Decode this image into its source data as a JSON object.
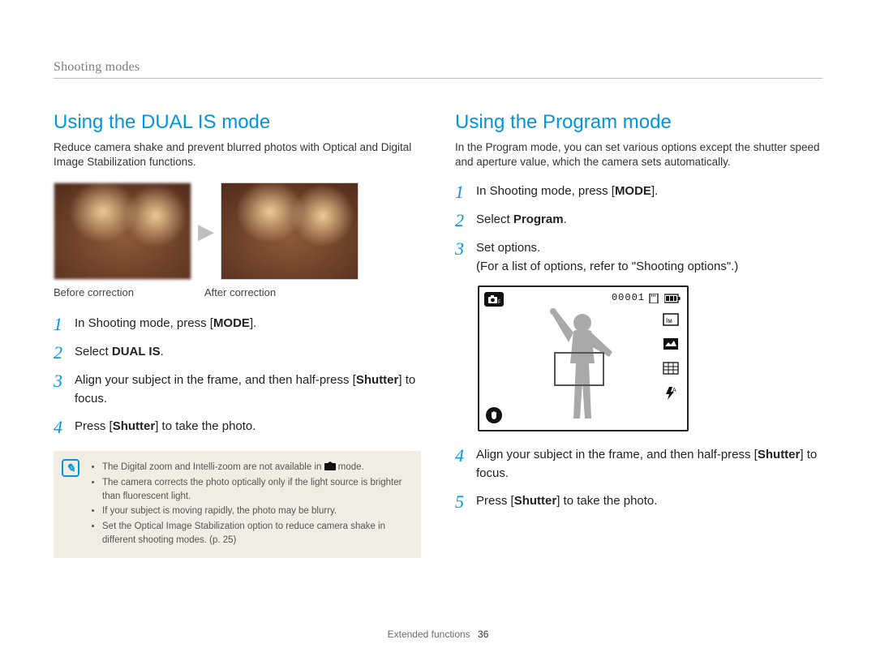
{
  "header": {
    "breadcrumb": "Shooting modes"
  },
  "left": {
    "title": "Using the DUAL IS mode",
    "intro": "Reduce camera shake and prevent blurred photos with Optical and Digital Image Stabilization functions.",
    "caption_before": "Before correction",
    "caption_after": "After correction",
    "steps": [
      {
        "n": "1",
        "pre": "In Shooting mode, press [",
        "bold": "MODE",
        "post": "]."
      },
      {
        "n": "2",
        "pre": "Select ",
        "bold": "DUAL IS",
        "post": "."
      },
      {
        "n": "3",
        "pre": "Align your subject in the frame, and then half-press [",
        "bold": "Shutter",
        "post": "] to focus."
      },
      {
        "n": "4",
        "pre": "Press [",
        "bold": "Shutter",
        "post": "] to take the photo."
      }
    ],
    "notes": [
      "The Digital zoom and Intelli-zoom are not available in ⌧ mode.",
      "The camera corrects the photo optically only if the light source is brighter than fluorescent light.",
      "If your subject is moving rapidly, the photo may be blurry.",
      "Set the Optical Image Stabilization option to reduce camera shake in different shooting modes. (p. 25)"
    ]
  },
  "right": {
    "title": "Using the Program mode",
    "intro": "In the Program mode, you can set various options except the shutter speed and aperture value, which the camera sets automatically.",
    "steps_a": [
      {
        "n": "1",
        "pre": "In Shooting mode, press [",
        "bold": "MODE",
        "post": "]."
      },
      {
        "n": "2",
        "pre": "Select ",
        "bold": "Program",
        "post": "."
      },
      {
        "n": "3",
        "line1": "Set options.",
        "line2": "(For a list of options, refer to \"Shooting options\".)"
      }
    ],
    "screen": {
      "counter": "00001",
      "mode_icon": "camera-p-icon",
      "right_icons": [
        "size-14m-icon",
        "quality-icon",
        "grid-icon",
        "flash-auto-icon"
      ],
      "stabilize_icon": "hand-steady-icon"
    },
    "steps_b": [
      {
        "n": "4",
        "pre": "Align your subject in the frame, and then half-press [",
        "bold": "Shutter",
        "post": "] to focus."
      },
      {
        "n": "5",
        "pre": "Press [",
        "bold": "Shutter",
        "post": "] to take the photo."
      }
    ]
  },
  "footer": {
    "section": "Extended functions",
    "page": "36"
  }
}
